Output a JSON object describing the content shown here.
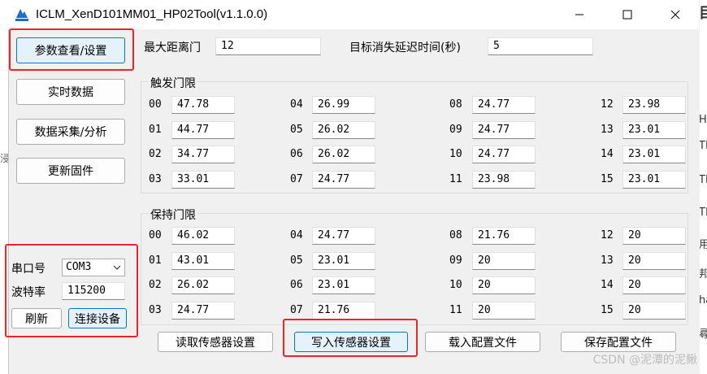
{
  "window": {
    "title": "ICLM_XenD101MM01_HP02Tool(v1.1.0.0)"
  },
  "left_nav": {
    "params_button": "参数查看/设置",
    "realtime_button": "实时数据",
    "collect_button": "数据采集/分析",
    "firmware_button": "更新固件"
  },
  "serial": {
    "port_label": "串口号",
    "port_value": "COM3",
    "baud_label": "波特率",
    "baud_value": "115200",
    "refresh_button": "刷新",
    "connect_button": "连接设备"
  },
  "top": {
    "max_distance_label": "最大距离门",
    "max_distance_value": "12",
    "delay_label": "目标消失延迟时间(秒)",
    "delay_value": "5"
  },
  "trigger": {
    "title": "触发门限",
    "items": [
      {
        "index": "00",
        "value": "47.78"
      },
      {
        "index": "01",
        "value": "44.77"
      },
      {
        "index": "02",
        "value": "34.77"
      },
      {
        "index": "03",
        "value": "33.01"
      },
      {
        "index": "04",
        "value": "26.99"
      },
      {
        "index": "05",
        "value": "26.02"
      },
      {
        "index": "06",
        "value": "26.02"
      },
      {
        "index": "07",
        "value": "24.77"
      },
      {
        "index": "08",
        "value": "24.77"
      },
      {
        "index": "09",
        "value": "24.77"
      },
      {
        "index": "10",
        "value": "24.77"
      },
      {
        "index": "11",
        "value": "23.98"
      },
      {
        "index": "12",
        "value": "23.98"
      },
      {
        "index": "13",
        "value": "23.01"
      },
      {
        "index": "14",
        "value": "23.01"
      },
      {
        "index": "15",
        "value": "23.01"
      }
    ]
  },
  "hold": {
    "title": "保持门限",
    "items": [
      {
        "index": "00",
        "value": "46.02"
      },
      {
        "index": "01",
        "value": "43.01"
      },
      {
        "index": "02",
        "value": "26.02"
      },
      {
        "index": "03",
        "value": "24.77"
      },
      {
        "index": "04",
        "value": "24.77"
      },
      {
        "index": "05",
        "value": "23.01"
      },
      {
        "index": "06",
        "value": "23.01"
      },
      {
        "index": "07",
        "value": "21.76"
      },
      {
        "index": "08",
        "value": "21.76"
      },
      {
        "index": "09",
        "value": "20"
      },
      {
        "index": "10",
        "value": "20"
      },
      {
        "index": "11",
        "value": "20"
      },
      {
        "index": "12",
        "value": "20"
      },
      {
        "index": "13",
        "value": "20"
      },
      {
        "index": "14",
        "value": "20"
      },
      {
        "index": "15",
        "value": "20"
      }
    ]
  },
  "bottom": {
    "read_button": "读取传感器设置",
    "write_button": "写入传感器设置",
    "load_button": "载入配置文件",
    "save_button": "保存配置文件"
  },
  "background_right": [
    "目",
    "H-",
    "TN",
    "TN",
    "TN",
    "用",
    "邦",
    "ha",
    "尋"
  ],
  "background_left": "浸",
  "watermark": "CSDN @泥潭的泥鳅",
  "colors": {
    "highlight": "#e8262a",
    "accent": "#0078d7"
  }
}
